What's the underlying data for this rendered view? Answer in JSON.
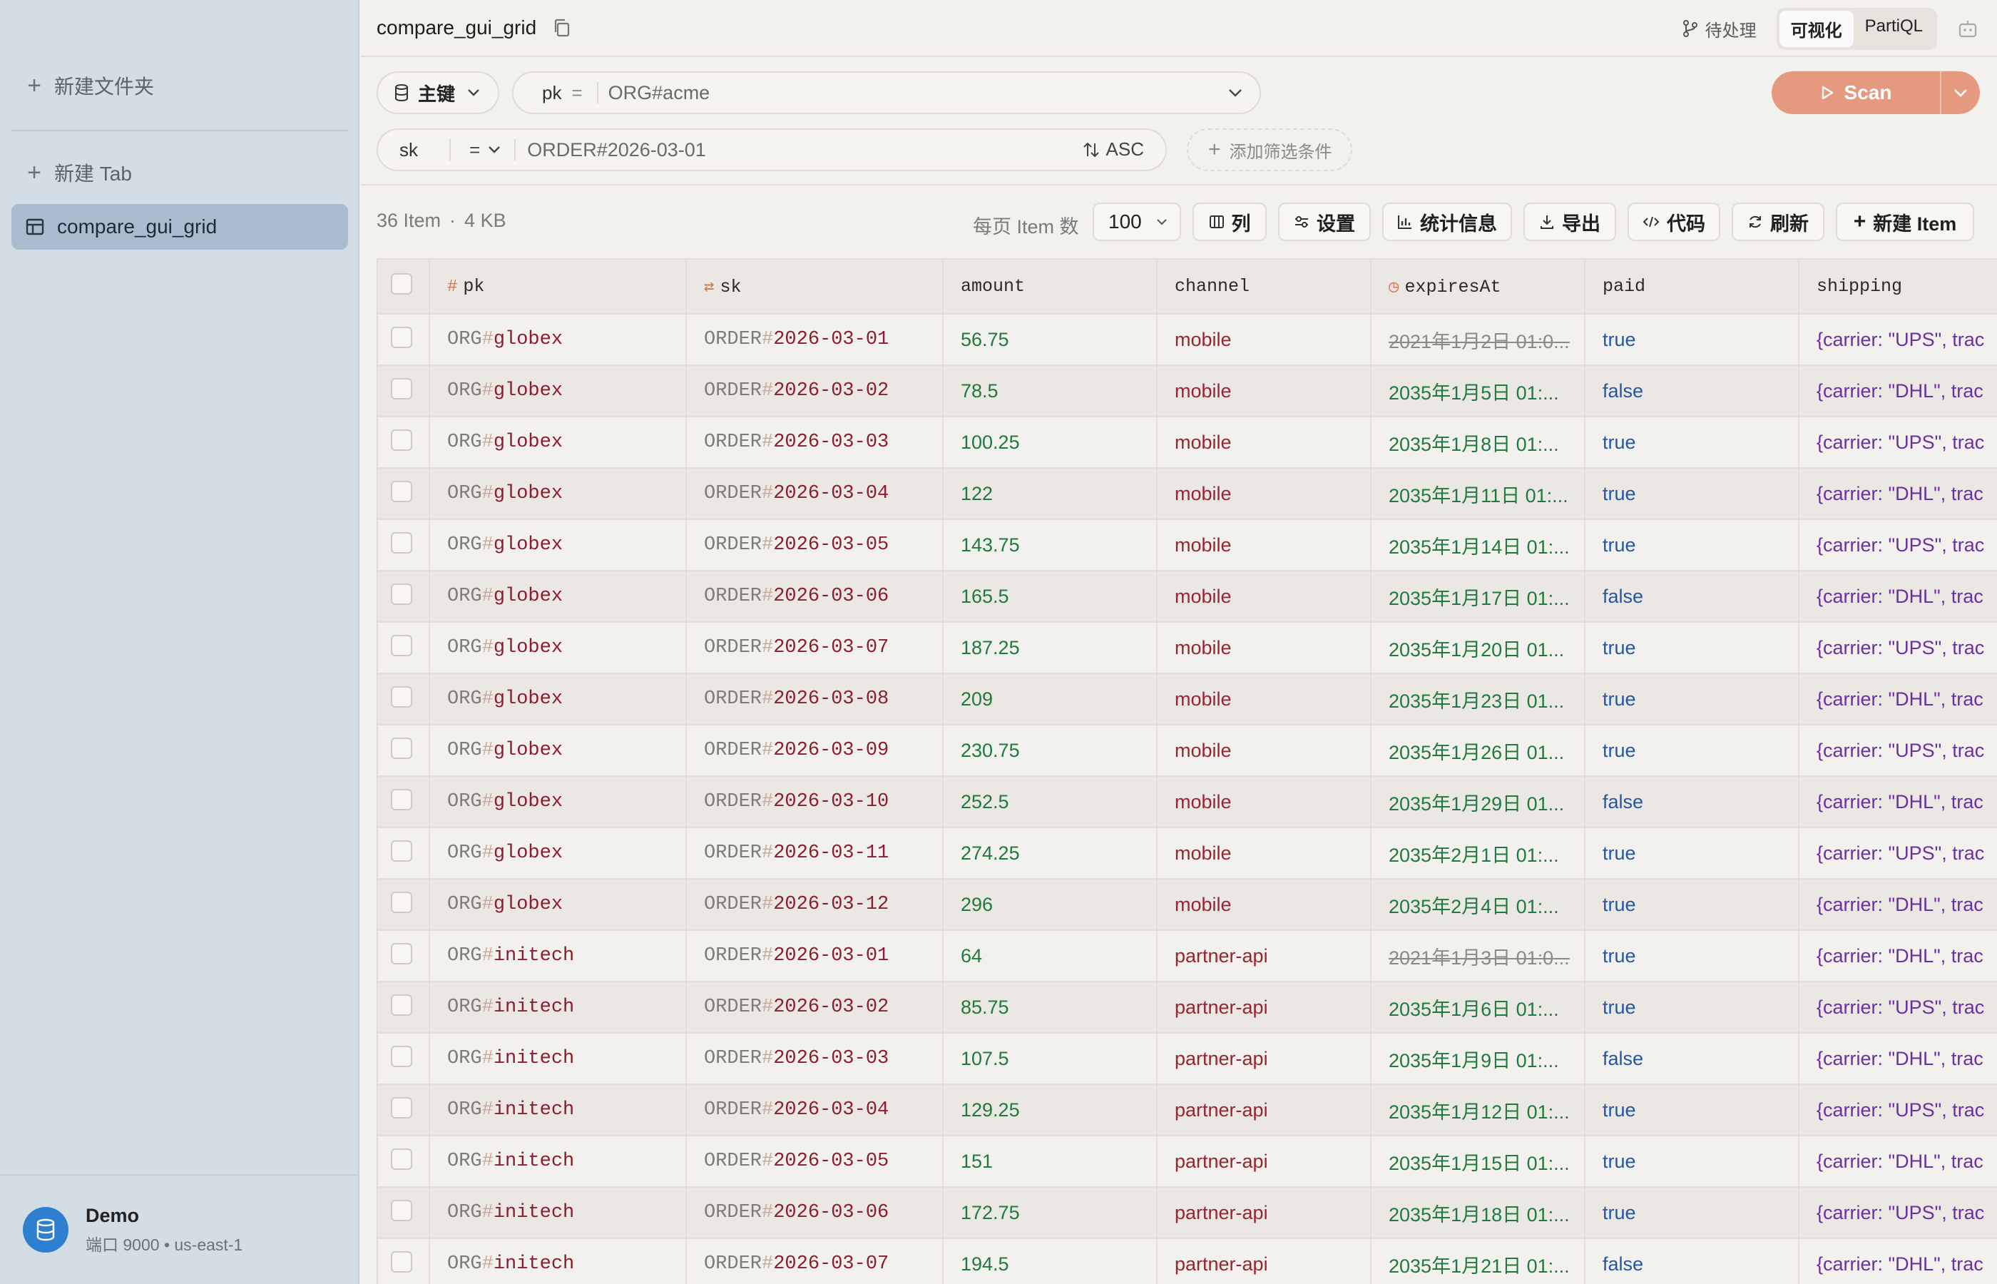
{
  "sidebar": {
    "new_folder": "新建文件夹",
    "new_tab": "新建 Tab",
    "items": [
      {
        "label": "compare_gui_grid"
      }
    ],
    "connection": {
      "name": "Demo",
      "detail": "端口 9000 • us-east-1"
    }
  },
  "header": {
    "title": "compare_gui_grid",
    "pending": "待处理",
    "mode_visual": "可视化",
    "mode_partiql": "PartiQL"
  },
  "query": {
    "index_label": "主键",
    "pk_name": "pk",
    "pk_op": "=",
    "pk_value": "ORG#acme",
    "sk_name": "sk",
    "sk_op": "=",
    "sk_value": "ORDER#2026-03-01",
    "sort": "ASC",
    "add_filter": "添加筛选条件",
    "scan_label": "Scan"
  },
  "toolbar": {
    "item_count": "36 Item",
    "size": "4 KB",
    "per_page_label": "每页 Item 数",
    "per_page_value": "100",
    "columns": "列",
    "settings": "设置",
    "stats": "统计信息",
    "export": "导出",
    "code": "代码",
    "refresh": "刷新",
    "new_item": "新建 Item"
  },
  "table": {
    "headers": {
      "pk": "pk",
      "sk": "sk",
      "amount": "amount",
      "channel": "channel",
      "expiresAt": "expiresAt",
      "paid": "paid",
      "shipping": "shipping"
    },
    "rows": [
      {
        "pk_prefix": "ORG",
        "pk_id": "globex",
        "sk_prefix": "ORDER",
        "sk_id": "2026-03-01",
        "amount": "56.75",
        "channel": "mobile",
        "expiresAt": "2021年1月2日 01:0...",
        "expired": true,
        "paid": "true",
        "shipping": "{carrier: \"UPS\", trac"
      },
      {
        "pk_prefix": "ORG",
        "pk_id": "globex",
        "sk_prefix": "ORDER",
        "sk_id": "2026-03-02",
        "amount": "78.5",
        "channel": "mobile",
        "expiresAt": "2035年1月5日 01:...",
        "expired": false,
        "paid": "false",
        "shipping": "{carrier: \"DHL\", trac"
      },
      {
        "pk_prefix": "ORG",
        "pk_id": "globex",
        "sk_prefix": "ORDER",
        "sk_id": "2026-03-03",
        "amount": "100.25",
        "channel": "mobile",
        "expiresAt": "2035年1月8日 01:...",
        "expired": false,
        "paid": "true",
        "shipping": "{carrier: \"UPS\", trac"
      },
      {
        "pk_prefix": "ORG",
        "pk_id": "globex",
        "sk_prefix": "ORDER",
        "sk_id": "2026-03-04",
        "amount": "122",
        "channel": "mobile",
        "expiresAt": "2035年1月11日 01:...",
        "expired": false,
        "paid": "true",
        "shipping": "{carrier: \"DHL\", trac"
      },
      {
        "pk_prefix": "ORG",
        "pk_id": "globex",
        "sk_prefix": "ORDER",
        "sk_id": "2026-03-05",
        "amount": "143.75",
        "channel": "mobile",
        "expiresAt": "2035年1月14日 01:...",
        "expired": false,
        "paid": "true",
        "shipping": "{carrier: \"UPS\", trac"
      },
      {
        "pk_prefix": "ORG",
        "pk_id": "globex",
        "sk_prefix": "ORDER",
        "sk_id": "2026-03-06",
        "amount": "165.5",
        "channel": "mobile",
        "expiresAt": "2035年1月17日 01:...",
        "expired": false,
        "paid": "false",
        "shipping": "{carrier: \"DHL\", trac"
      },
      {
        "pk_prefix": "ORG",
        "pk_id": "globex",
        "sk_prefix": "ORDER",
        "sk_id": "2026-03-07",
        "amount": "187.25",
        "channel": "mobile",
        "expiresAt": "2035年1月20日 01...",
        "expired": false,
        "paid": "true",
        "shipping": "{carrier: \"UPS\", trac"
      },
      {
        "pk_prefix": "ORG",
        "pk_id": "globex",
        "sk_prefix": "ORDER",
        "sk_id": "2026-03-08",
        "amount": "209",
        "channel": "mobile",
        "expiresAt": "2035年1月23日 01...",
        "expired": false,
        "paid": "true",
        "shipping": "{carrier: \"DHL\", trac"
      },
      {
        "pk_prefix": "ORG",
        "pk_id": "globex",
        "sk_prefix": "ORDER",
        "sk_id": "2026-03-09",
        "amount": "230.75",
        "channel": "mobile",
        "expiresAt": "2035年1月26日 01...",
        "expired": false,
        "paid": "true",
        "shipping": "{carrier: \"UPS\", trac"
      },
      {
        "pk_prefix": "ORG",
        "pk_id": "globex",
        "sk_prefix": "ORDER",
        "sk_id": "2026-03-10",
        "amount": "252.5",
        "channel": "mobile",
        "expiresAt": "2035年1月29日 01...",
        "expired": false,
        "paid": "false",
        "shipping": "{carrier: \"DHL\", trac"
      },
      {
        "pk_prefix": "ORG",
        "pk_id": "globex",
        "sk_prefix": "ORDER",
        "sk_id": "2026-03-11",
        "amount": "274.25",
        "channel": "mobile",
        "expiresAt": "2035年2月1日 01:...",
        "expired": false,
        "paid": "true",
        "shipping": "{carrier: \"UPS\", trac"
      },
      {
        "pk_prefix": "ORG",
        "pk_id": "globex",
        "sk_prefix": "ORDER",
        "sk_id": "2026-03-12",
        "amount": "296",
        "channel": "mobile",
        "expiresAt": "2035年2月4日 01:...",
        "expired": false,
        "paid": "true",
        "shipping": "{carrier: \"DHL\", trac"
      },
      {
        "pk_prefix": "ORG",
        "pk_id": "initech",
        "sk_prefix": "ORDER",
        "sk_id": "2026-03-01",
        "amount": "64",
        "channel": "partner-api",
        "expiresAt": "2021年1月3日 01:0...",
        "expired": true,
        "paid": "true",
        "shipping": "{carrier: \"DHL\", trac"
      },
      {
        "pk_prefix": "ORG",
        "pk_id": "initech",
        "sk_prefix": "ORDER",
        "sk_id": "2026-03-02",
        "amount": "85.75",
        "channel": "partner-api",
        "expiresAt": "2035年1月6日 01:...",
        "expired": false,
        "paid": "true",
        "shipping": "{carrier: \"UPS\", trac"
      },
      {
        "pk_prefix": "ORG",
        "pk_id": "initech",
        "sk_prefix": "ORDER",
        "sk_id": "2026-03-03",
        "amount": "107.5",
        "channel": "partner-api",
        "expiresAt": "2035年1月9日 01:...",
        "expired": false,
        "paid": "false",
        "shipping": "{carrier: \"DHL\", trac"
      },
      {
        "pk_prefix": "ORG",
        "pk_id": "initech",
        "sk_prefix": "ORDER",
        "sk_id": "2026-03-04",
        "amount": "129.25",
        "channel": "partner-api",
        "expiresAt": "2035年1月12日 01:...",
        "expired": false,
        "paid": "true",
        "shipping": "{carrier: \"UPS\", trac"
      },
      {
        "pk_prefix": "ORG",
        "pk_id": "initech",
        "sk_prefix": "ORDER",
        "sk_id": "2026-03-05",
        "amount": "151",
        "channel": "partner-api",
        "expiresAt": "2035年1月15日 01:...",
        "expired": false,
        "paid": "true",
        "shipping": "{carrier: \"DHL\", trac"
      },
      {
        "pk_prefix": "ORG",
        "pk_id": "initech",
        "sk_prefix": "ORDER",
        "sk_id": "2026-03-06",
        "amount": "172.75",
        "channel": "partner-api",
        "expiresAt": "2035年1月18日 01:...",
        "expired": false,
        "paid": "true",
        "shipping": "{carrier: \"UPS\", trac"
      },
      {
        "pk_prefix": "ORG",
        "pk_id": "initech",
        "sk_prefix": "ORDER",
        "sk_id": "2026-03-07",
        "amount": "194.5",
        "channel": "partner-api",
        "expiresAt": "2035年1月21日 01:...",
        "expired": false,
        "paid": "false",
        "shipping": "{carrier: \"DHL\", trac"
      }
    ]
  }
}
